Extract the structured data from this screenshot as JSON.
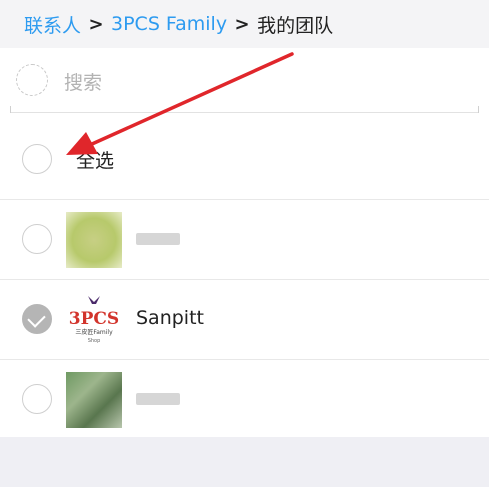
{
  "breadcrumb": {
    "items": [
      {
        "label": "联系人",
        "link": true
      },
      {
        "label": "3PCS Family",
        "link": true
      },
      {
        "label": "我的团队",
        "link": false
      }
    ],
    "separator": ">"
  },
  "search": {
    "placeholder": "搜索"
  },
  "select_all": {
    "label": "全选",
    "checked": false
  },
  "members": [
    {
      "name": "",
      "name_blurred": true,
      "checked": false,
      "avatar": "blurred-photo"
    },
    {
      "name": "Sanpitt",
      "name_blurred": false,
      "checked": true,
      "avatar": "3pcs-family-logo"
    },
    {
      "name": "",
      "name_blurred": true,
      "checked": false,
      "avatar": "blurred-photo"
    }
  ],
  "logo_text": {
    "main": "3PCS",
    "line2": "三皮匠Family",
    "line3": "Shop"
  },
  "annotation": {
    "type": "arrow",
    "color": "#e0262b",
    "points_to": "select-all-radio"
  }
}
